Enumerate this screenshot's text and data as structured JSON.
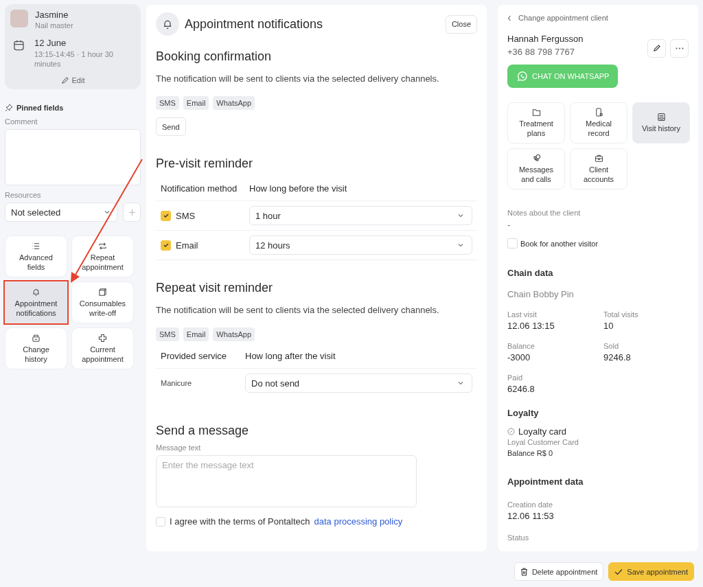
{
  "staff": {
    "name": "Jasmine",
    "role": "Nail master"
  },
  "appointment": {
    "date": "12 June",
    "time": "13:15-14:45 · 1 hour 30 minutes",
    "edit": "Edit"
  },
  "pinned": {
    "title": "Pinned fields",
    "comment_label": "Comment",
    "resources_label": "Resources",
    "resources_value": "Not selected"
  },
  "actions": [
    {
      "label": "Advanced fields",
      "kind": "list",
      "selected": false,
      "highlighted": false
    },
    {
      "label": "Repeat appointment",
      "kind": "repeat",
      "selected": false,
      "highlighted": false
    },
    {
      "label": "Appointment notifications",
      "kind": "bell",
      "selected": true,
      "highlighted": true
    },
    {
      "label": "Consumables write-off",
      "kind": "cube",
      "selected": false,
      "highlighted": false
    },
    {
      "label": "Change history",
      "kind": "box",
      "selected": false,
      "highlighted": false
    },
    {
      "label": "Current appointment",
      "kind": "plus",
      "selected": false,
      "highlighted": false
    }
  ],
  "notifications": {
    "title": "Appointment notifications",
    "close": "Close",
    "booking": {
      "title": "Booking confirmation",
      "text": "The notification will be sent to clients via the selected delivery channels.",
      "channels": [
        "SMS",
        "Email",
        "WhatsApp"
      ],
      "send": "Send"
    },
    "pre_visit": {
      "title": "Pre-visit reminder",
      "columns": [
        "Notification method",
        "How long before the visit"
      ],
      "rows": [
        {
          "method": "SMS",
          "checked": true,
          "value": "1 hour"
        },
        {
          "method": "Email",
          "checked": true,
          "value": "12 hours"
        }
      ]
    },
    "repeat": {
      "title": "Repeat visit reminder",
      "text": "The notification will be sent to clients via the selected delivery channels.",
      "channels": [
        "SMS",
        "Email",
        "WhatsApp"
      ],
      "columns": [
        "Provided service",
        "How long after the visit"
      ],
      "rows": [
        {
          "service": "Manicure",
          "value": "Do not send"
        }
      ]
    },
    "message": {
      "title": "Send a message",
      "label": "Message text",
      "placeholder": "Enter the message text",
      "agree_text": "I agree with the terms of Pontaltech",
      "agree_link": "data processing policy",
      "agree_checked": false
    }
  },
  "client": {
    "back": "Change appointment client",
    "name": "Hannah Fergusson",
    "phone": "+36 88 798 7767",
    "whatsapp": "CHAT ON WHATSAPP",
    "tiles": [
      {
        "label": "Treatment plans",
        "kind": "folder",
        "selected": false
      },
      {
        "label": "Medical record",
        "kind": "phone",
        "selected": false
      },
      {
        "label": "Visit history",
        "kind": "inbox",
        "selected": true
      },
      {
        "label": "Messages and calls",
        "kind": "call",
        "selected": false
      },
      {
        "label": "Client accounts",
        "kind": "briefcase",
        "selected": false
      }
    ],
    "notes_label": "Notes about the client",
    "notes_value": "-",
    "another_visitor": "Book for another visitor",
    "another_visitor_checked": false,
    "chain_title": "Chain data",
    "chain_name": "Chain Bobby Pin",
    "stats": [
      {
        "label": "Last visit",
        "value": "12.06 13:15"
      },
      {
        "label": "Total visits",
        "value": "10"
      },
      {
        "label": "Balance",
        "value": "-3000"
      },
      {
        "label": "Sold",
        "value": "9246.8"
      },
      {
        "label": "Paid",
        "value": "6246.8"
      }
    ],
    "loyalty_title": "Loyalty",
    "loyalty_card": "Loyalty card",
    "loyalty_card_name": "Loyal Customer Card",
    "loyalty_balance": "Balance R$ 0",
    "appt_title": "Appointment data",
    "creation_label": "Creation date",
    "creation_value": "12.06 11:53",
    "status_label": "Status"
  },
  "footer": {
    "delete": "Delete appointment",
    "save": "Save appointment"
  }
}
